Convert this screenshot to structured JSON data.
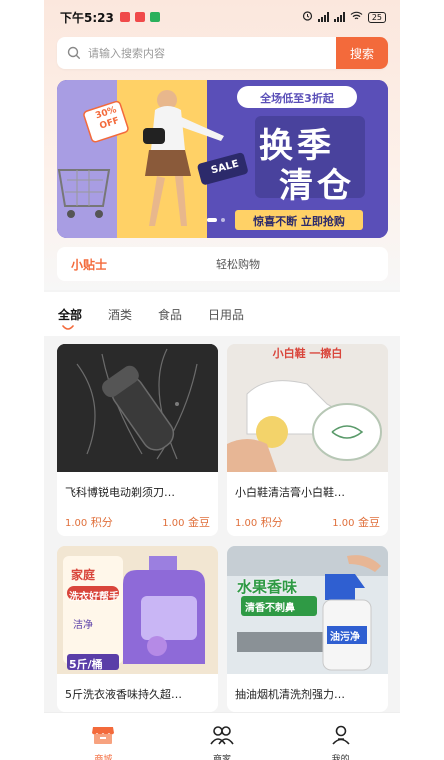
{
  "status": {
    "time": "下午5:23",
    "battery": "25",
    "app_colors": [
      "#f04a4a",
      "#f04a4a",
      "#2bb05c"
    ]
  },
  "search": {
    "placeholder": "请输入搜索内容",
    "button_label": "搜索",
    "icon": "search-icon"
  },
  "banner": {
    "badge_top": "全场低至3折起",
    "headline_line1": "换季",
    "headline_line2": "清仓",
    "tagline": "惊喜不断 立即抢购",
    "tag_sale": "SALE",
    "tag_off_line1": "30%",
    "tag_off_line2": "OFF",
    "colors": {
      "purple": "#6c61c4",
      "dark": "#2c2a6b",
      "yellow": "#ffd166",
      "orange": "#f36a3b"
    }
  },
  "tips": {
    "title": "小贴士",
    "text": "轻松购物"
  },
  "tabs": [
    {
      "label": "全部",
      "active": true
    },
    {
      "label": "酒类",
      "active": false
    },
    {
      "label": "食品",
      "active": false
    },
    {
      "label": "日用品",
      "active": false
    }
  ],
  "products": [
    {
      "name": "飞科博锐电动剃须刀…",
      "points": "1.00",
      "points_unit": "积分",
      "beans": "1.00",
      "beans_unit": "金豆",
      "image": "shaver"
    },
    {
      "name": "小白鞋清洁膏小白鞋…",
      "points": "1.00",
      "points_unit": "积分",
      "beans": "1.00",
      "beans_unit": "金豆",
      "image": "shoe-cleaner",
      "image_text": "小白鞋 一擦白"
    },
    {
      "name": "5斤洗衣液香味持久超…",
      "image": "laundry",
      "image_text_1": "家庭",
      "image_text_2": "洗衣好帮手",
      "image_text_3": "5斤/桶",
      "image_text_4": "洁净"
    },
    {
      "name": "抽油烟机清洗剂强力…",
      "image": "hood-cleaner",
      "image_text_1": "水果香味",
      "image_text_2": "清香不刺鼻",
      "image_text_3": "油污净"
    }
  ],
  "tabbar": [
    {
      "label": "商城",
      "icon": "shop-icon",
      "active": true
    },
    {
      "label": "商家",
      "icon": "merchants-icon",
      "active": false
    },
    {
      "label": "我的",
      "icon": "profile-icon",
      "active": false
    }
  ],
  "accent": "#f36a3b"
}
